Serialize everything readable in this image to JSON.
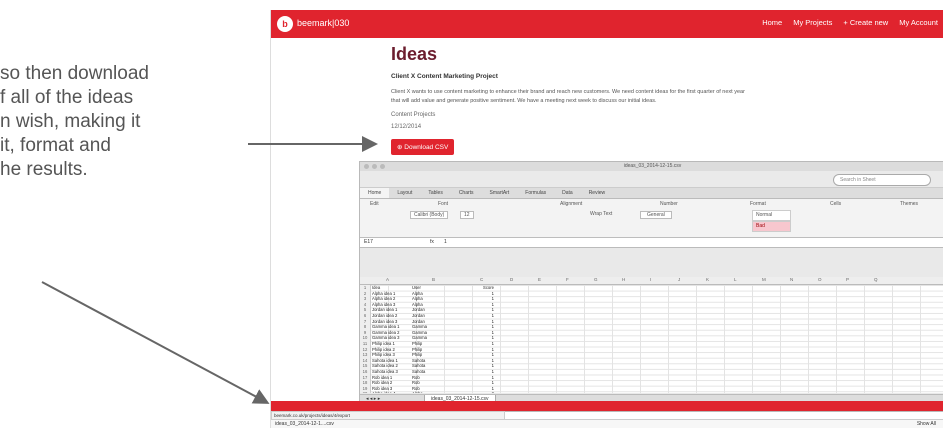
{
  "callout": {
    "lines": [
      "so then download",
      "f all of the ideas",
      "n wish, making it",
      "it, format and",
      "he results."
    ]
  },
  "app": {
    "brand": "beemark|030",
    "logo_text": "b",
    "nav": [
      "Home",
      "My Projects",
      "+ Create new",
      "My Account"
    ],
    "accent": "#e0242e"
  },
  "page": {
    "title": "Ideas",
    "project_name": "Client X Content Marketing Project",
    "description_line1": "Client X wants to use content marketing to enhance their brand and reach new customers. We need content ideas for the first quarter of next year",
    "description_line2": "that will add value and generate positive sentiment. We have a meeting next week to discuss our initial ideas.",
    "breadcrumb": "Content Projects",
    "date": "12/12/2014",
    "download_button": "Download CSV"
  },
  "excel": {
    "window_title": "ideas_03_2014-12-15.csv",
    "search_placeholder": "Search in Sheet",
    "tabs": [
      "Home",
      "Layout",
      "Tables",
      "Charts",
      "SmartArt",
      "Formulas",
      "Data",
      "Review"
    ],
    "ribbon_groups": [
      "Edit",
      "Font",
      "Alignment",
      "Number",
      "Format",
      "Cells",
      "Themes"
    ],
    "font_name": "Calibri (Body)",
    "font_size": "12",
    "wrap_text": "Wrap Text",
    "number_format": "General",
    "style_normal": "Normal",
    "style_bad": "Bad",
    "cell_ref": "E17",
    "formula_value": "1",
    "columns": [
      "A",
      "B",
      "C",
      "D",
      "E",
      "F",
      "G",
      "H",
      "I",
      "J",
      "K",
      "L",
      "M",
      "N",
      "O",
      "P",
      "Q"
    ],
    "rows": [
      [
        "Idea",
        "User",
        "Score"
      ],
      [
        "Alpha idea 1",
        "Alpha",
        "1"
      ],
      [
        "Alpha idea 2",
        "Alpha",
        "1"
      ],
      [
        "Alpha idea 3",
        "Alpha",
        "1"
      ],
      [
        "Jordan idea 1",
        "Jordan",
        "1"
      ],
      [
        "Jordan idea 2",
        "Jordan",
        "1"
      ],
      [
        "Jordan idea 3",
        "Jordan",
        "1"
      ],
      [
        "Gamma idea 1",
        "Gamma",
        "1"
      ],
      [
        "Gamma idea 2",
        "Gamma",
        "1"
      ],
      [
        "Gamma idea 3",
        "Gamma",
        "1"
      ],
      [
        "Philip idea 1",
        "Philip",
        "1"
      ],
      [
        "Philip idea 2",
        "Philip",
        "1"
      ],
      [
        "Philip idea 3",
        "Philip",
        "1"
      ],
      [
        "Sahota idea 1",
        "Sahota",
        "1"
      ],
      [
        "Sahota idea 2",
        "Sahota",
        "1"
      ],
      [
        "Sahota idea 3",
        "Sahota",
        "1"
      ],
      [
        "Rob idea 1",
        "Rob",
        "1"
      ],
      [
        "Rob idea 2",
        "Rob",
        "1"
      ],
      [
        "Rob idea 3",
        "Rob",
        "1"
      ],
      [
        "Alpha idea 4",
        "Alpha",
        "2"
      ],
      [
        "Alpha idea 5",
        "Alpha",
        "2"
      ],
      [
        "Alpha idea 6",
        "Alpha",
        "2"
      ],
      [
        "Jordan idea 4",
        "Jordan",
        "2"
      ],
      [
        "Jordan idea 5",
        "Jordan",
        "2"
      ]
    ],
    "sheet_tab": "ideas_03_2014-12-15.csv"
  },
  "browser": {
    "status_url": "beemark.co.uk/projects/ideas/4/export",
    "download_item": "ideas_03_2014-12-1....csv",
    "show_all": "Show All"
  }
}
